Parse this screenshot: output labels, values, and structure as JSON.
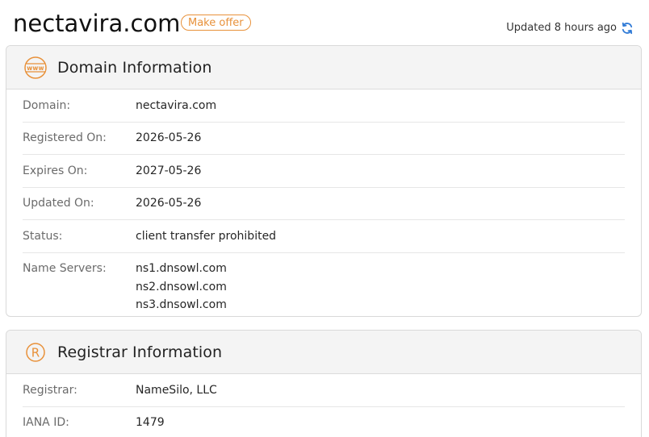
{
  "header": {
    "domain": "nectavira.com",
    "offer_label": "Make offer",
    "updated_text": "Updated 8 hours ago"
  },
  "domain_info": {
    "title": "Domain Information",
    "icon": "www-globe-icon",
    "rows": {
      "domain": {
        "label": "Domain:",
        "value": "nectavira.com"
      },
      "registered": {
        "label": "Registered On:",
        "value": "2026-05-26"
      },
      "expires": {
        "label": "Expires On:",
        "value": "2027-05-26"
      },
      "updated": {
        "label": "Updated On:",
        "value": "2026-05-26"
      },
      "status": {
        "label": "Status:",
        "value": "client transfer prohibited"
      },
      "name_servers": {
        "label": "Name Servers:",
        "values": [
          "ns1.dnsowl.com",
          "ns2.dnsowl.com",
          "ns3.dnsowl.com"
        ]
      }
    }
  },
  "registrar_info": {
    "title": "Registrar Information",
    "icon": "registered-trademark-icon",
    "rows": {
      "registrar": {
        "label": "Registrar:",
        "value": "NameSilo, LLC"
      },
      "iana": {
        "label": "IANA ID:",
        "value": "1479"
      }
    }
  },
  "colors": {
    "accent_orange": "#e8913a",
    "refresh_blue": "#2f7ad6",
    "header_bg": "#f4f4f4"
  }
}
